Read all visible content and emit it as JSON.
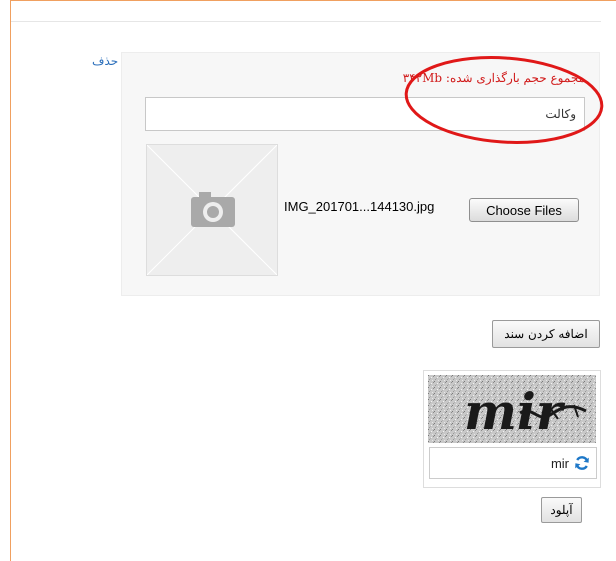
{
  "document": {
    "delete_label": "حذف",
    "total_size_label": "مجموع حجم بارگذاری شده: ۳۴۲Mb",
    "title_value": "وکالت",
    "file_name": "IMG_201701...144130.jpg",
    "choose_files_label": "Choose Files",
    "thumbnail_icon": "camera-icon"
  },
  "actions": {
    "add_document_label": "اضافه کردن سند",
    "upload_label": "آپلود"
  },
  "captcha": {
    "image_text": "mir",
    "value": "mir",
    "refresh_icon": "refresh-icon"
  },
  "colors": {
    "frame_border": "#f0a060",
    "link": "#2a6ebb",
    "warning_text": "#d11b1b",
    "annotation": "#e01818",
    "refresh_icon": "#1e78c8"
  }
}
